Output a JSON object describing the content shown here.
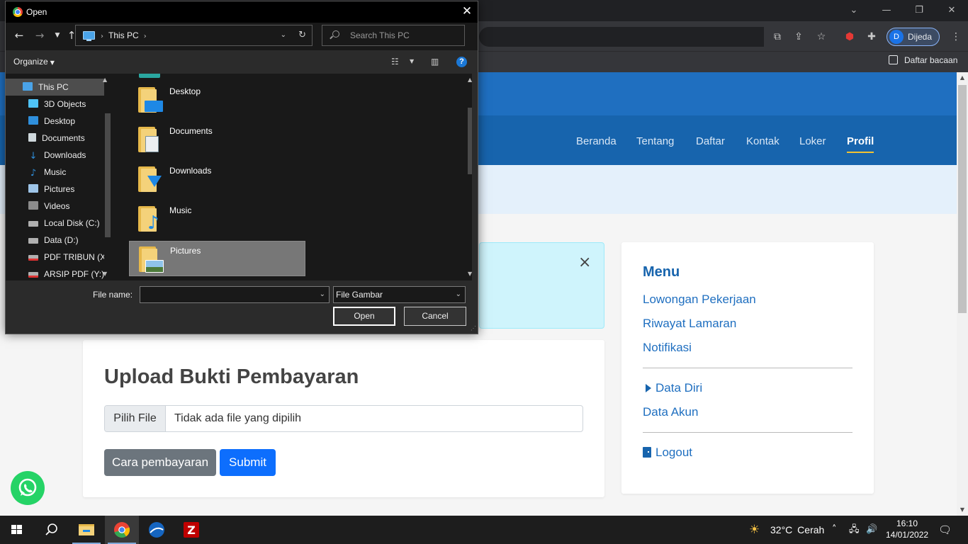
{
  "browser": {
    "reading_list_label": "Daftar bacaan",
    "profile_name": "Dijeda",
    "profile_initial": "D"
  },
  "site": {
    "nav": [
      "Beranda",
      "Tentang",
      "Daftar",
      "Kontak",
      "Loker",
      "Profil"
    ],
    "active_nav": "Profil",
    "upload": {
      "title": "Upload Bukti Pembayaran",
      "file_button": "Pilih File",
      "file_placeholder": "Tidak ada file yang dipilih",
      "guide_button": "Cara pembayaran",
      "submit_button": "Submit"
    },
    "menu": {
      "title": "Menu",
      "links": [
        "Lowongan Pekerjaan",
        "Riwayat Lamaran",
        "Notifikasi"
      ],
      "data_diri": "Data Diri",
      "data_akun": "Data Akun",
      "logout": "Logout"
    },
    "alert_close": "×"
  },
  "dialog": {
    "title": "Open",
    "address": {
      "location": "This PC"
    },
    "search_placeholder": "Search This PC",
    "organize_label": "Organize",
    "tree": [
      {
        "label": "This PC",
        "icon": "pc-icon",
        "color": "#4aa3e8"
      },
      {
        "label": "3D Objects",
        "icon": "cube-icon",
        "color": "#4fc3f7"
      },
      {
        "label": "Desktop",
        "icon": "desktop-icon",
        "color": "#2f8fdc"
      },
      {
        "label": "Documents",
        "icon": "document-icon",
        "color": "#cfd8dc"
      },
      {
        "label": "Downloads",
        "icon": "download-icon",
        "color": "#2f8fdc"
      },
      {
        "label": "Music",
        "icon": "music-icon",
        "color": "#2f8fdc"
      },
      {
        "label": "Pictures",
        "icon": "pictures-icon",
        "color": "#9ec5e8"
      },
      {
        "label": "Videos",
        "icon": "video-icon",
        "color": "#8b8b8b"
      },
      {
        "label": "Local Disk (C:)",
        "icon": "drive-icon",
        "color": "#b0b0b0"
      },
      {
        "label": "Data (D:)",
        "icon": "drive-icon",
        "color": "#b0b0b0"
      },
      {
        "label": "PDF TRIBUN (X:)",
        "icon": "network-drive-icon",
        "color": "#b0b0b0"
      },
      {
        "label": "ARSIP PDF (Y:)",
        "icon": "network-drive-icon",
        "color": "#b0b0b0"
      }
    ],
    "items": [
      {
        "label": "Desktop",
        "icon": "desktop-folder-icon"
      },
      {
        "label": "Documents",
        "icon": "documents-folder-icon"
      },
      {
        "label": "Downloads",
        "icon": "downloads-folder-icon"
      },
      {
        "label": "Music",
        "icon": "music-folder-icon"
      },
      {
        "label": "Pictures",
        "icon": "pictures-folder-icon"
      }
    ],
    "selected_item": "Pictures",
    "file_name_label": "File name:",
    "file_name_value": "",
    "file_type": "File Gambar",
    "open_button": "Open",
    "cancel_button": "Cancel"
  },
  "taskbar": {
    "weather": {
      "temp": "32°C",
      "condition": "Cerah"
    },
    "time": "16:10",
    "date": "14/01/2022"
  },
  "colors": {
    "site_header": "#1f6fc0",
    "site_nav": "#1764ad",
    "primary_button": "#0d6efd",
    "secondary_button": "#6c757d",
    "whatsapp": "#25d366",
    "dialog_bg": "#2b2b2b"
  }
}
